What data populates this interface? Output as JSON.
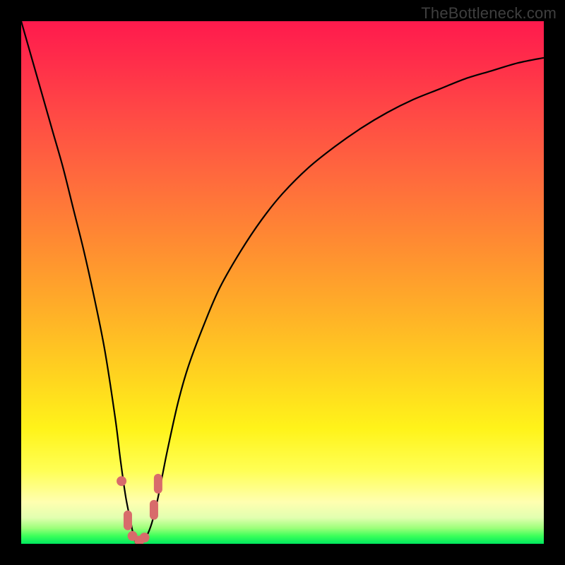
{
  "watermark": "TheBottleneck.com",
  "colors": {
    "frame": "#000000",
    "curve": "#000000",
    "marker": "#d86b6b"
  },
  "chart_data": {
    "type": "line",
    "title": "",
    "xlabel": "",
    "ylabel": "",
    "xlim": [
      0,
      100
    ],
    "ylim": [
      0,
      100
    ],
    "x": [
      0,
      2,
      4,
      6,
      8,
      10,
      12,
      14,
      16,
      18,
      19,
      20,
      21,
      21.5,
      22,
      22.5,
      23,
      24,
      25,
      26,
      27,
      28,
      30,
      32,
      35,
      38,
      42,
      46,
      50,
      55,
      60,
      65,
      70,
      75,
      80,
      85,
      90,
      95,
      100
    ],
    "y": [
      100,
      93,
      86,
      79,
      72,
      64,
      56,
      47,
      37,
      24,
      16,
      9,
      4,
      1.5,
      0,
      0,
      0.5,
      1.5,
      4,
      8,
      13,
      18,
      27,
      34,
      42,
      49,
      56,
      62,
      67,
      72,
      76,
      79.5,
      82.5,
      85,
      87,
      89,
      90.5,
      92,
      93
    ],
    "markers": [
      {
        "x": 19.2,
        "y": 12,
        "shape": "circle"
      },
      {
        "x": 20.4,
        "y": 4.5,
        "shape": "pill-v"
      },
      {
        "x": 21.3,
        "y": 1.5,
        "shape": "circle"
      },
      {
        "x": 22.6,
        "y": 0.6,
        "shape": "circle"
      },
      {
        "x": 23.6,
        "y": 1.2,
        "shape": "circle"
      },
      {
        "x": 25.4,
        "y": 6.5,
        "shape": "pill-v"
      },
      {
        "x": 26.2,
        "y": 11.5,
        "shape": "pill-v"
      }
    ],
    "background_gradient": {
      "direction": "vertical",
      "stops": [
        {
          "pos": 0.0,
          "color": "#ff1a4d"
        },
        {
          "pos": 0.3,
          "color": "#ff6a3d"
        },
        {
          "pos": 0.68,
          "color": "#ffd41f"
        },
        {
          "pos": 0.92,
          "color": "#ffffb0"
        },
        {
          "pos": 1.0,
          "color": "#00e85e"
        }
      ]
    }
  }
}
